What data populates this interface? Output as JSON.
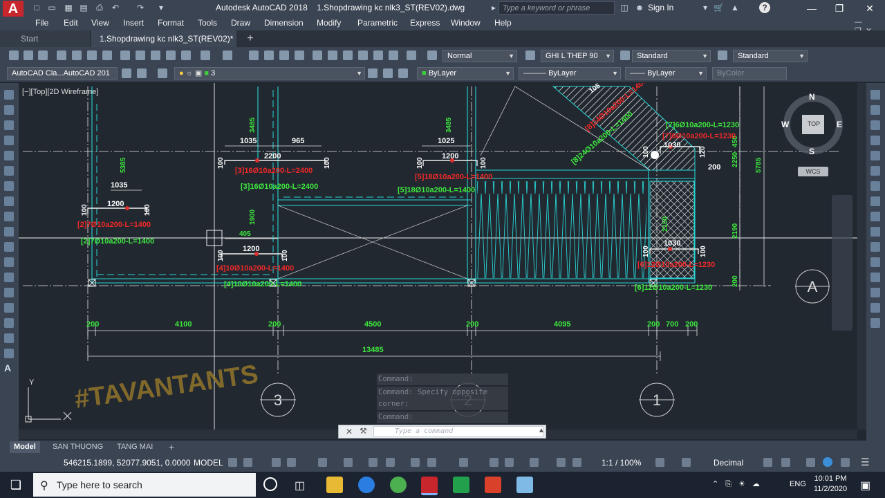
{
  "titlebar": {
    "app_name": "Autodesk AutoCAD 2018",
    "file_name": "1.Shopdrawing kc nlk3_ST(REV02).dwg",
    "search_placeholder": "Type a keyword or phrase",
    "sign_in": "Sign In",
    "help": "?"
  },
  "menu": [
    "File",
    "Edit",
    "View",
    "Insert",
    "Format",
    "Tools",
    "Draw",
    "Dimension",
    "Modify",
    "Parametric",
    "Express",
    "Window",
    "Help"
  ],
  "tabs": {
    "start": "Start",
    "drawing": "1.Shopdrawing kc nlk3_ST(REV02)*",
    "new": "+"
  },
  "toolbar1": {
    "text_style": "Normal",
    "dim_style": "GHI L THEP 90",
    "table_style": "Standard",
    "mleader_style": "Standard"
  },
  "toolbar2": {
    "workspace": "AutoCAD Cla...AutoCAD 201",
    "layer": "3",
    "color": "ByLayer",
    "linetype": "ByLayer",
    "lineweight": "ByLayer",
    "plotstyle": "ByColor"
  },
  "viewport": {
    "label": "[−][Top][2D Wireframe]"
  },
  "viewcube": {
    "north": "N",
    "south": "S",
    "east": "E",
    "west": "W",
    "top": "TOP",
    "ucs": "WCS"
  },
  "drawing": {
    "rebar_labels": [
      "[3]16Ø10a200-L=2400",
      "[3]16Ø10a200-L=2400",
      "[2]7Ø10a200-L=1400",
      "[2]7Ø10a200-L=1400",
      "[4]10Ø10a200-L=1400",
      "[4]10Ø10a200-L=1400",
      "[5]18Ø10a200-L=1400",
      "[5]18Ø10a200-L=1400",
      "[7]6Ø10a200-L=1230",
      "[7]6Ø10a200-L=1230",
      "[6]12Ø10a200-L=1230",
      "[6]12Ø10a200-L=1230",
      "[8]24Ø10a200-L=1400",
      "[8]24Ø10a200-L=1400"
    ],
    "dims_top": [
      "1035",
      "965",
      "2200",
      "1025",
      "1200",
      "1200",
      "1200",
      "1030",
      "1030",
      "3485",
      "3485",
      "5385",
      "5785",
      "2150",
      "1900",
      "1035",
      "405",
      "450",
      "2250",
      "2190",
      "200",
      "200",
      "100",
      "100",
      "100",
      "100",
      "100",
      "100",
      "100",
      "100",
      "100",
      "100",
      "100",
      "120",
      "105"
    ],
    "dims_bottom": [
      "200",
      "4100",
      "200",
      "4500",
      "200",
      "4095",
      "200",
      "700",
      "200"
    ],
    "dim_total": "13485",
    "grid_bubbles": [
      "3",
      "2",
      "1",
      "A"
    ],
    "watermark": "#TAVANTANTS"
  },
  "command": {
    "history": [
      "Command:",
      "Command: Specify opposite corner:",
      "Command:"
    ],
    "placeholder": "Type a command"
  },
  "layout_tabs": [
    "Model",
    "SAN THUONG",
    "TANG MAI",
    "+"
  ],
  "status": {
    "coords": "546215.1899, 52077.9051, 0.0000",
    "space": "MODEL",
    "annotation_scale": "1:1 / 100%",
    "units": "Decimal"
  },
  "taskbar": {
    "search": "Type here to search",
    "language": "ENG",
    "time": "10:01 PM",
    "date": "11/2/2020"
  }
}
